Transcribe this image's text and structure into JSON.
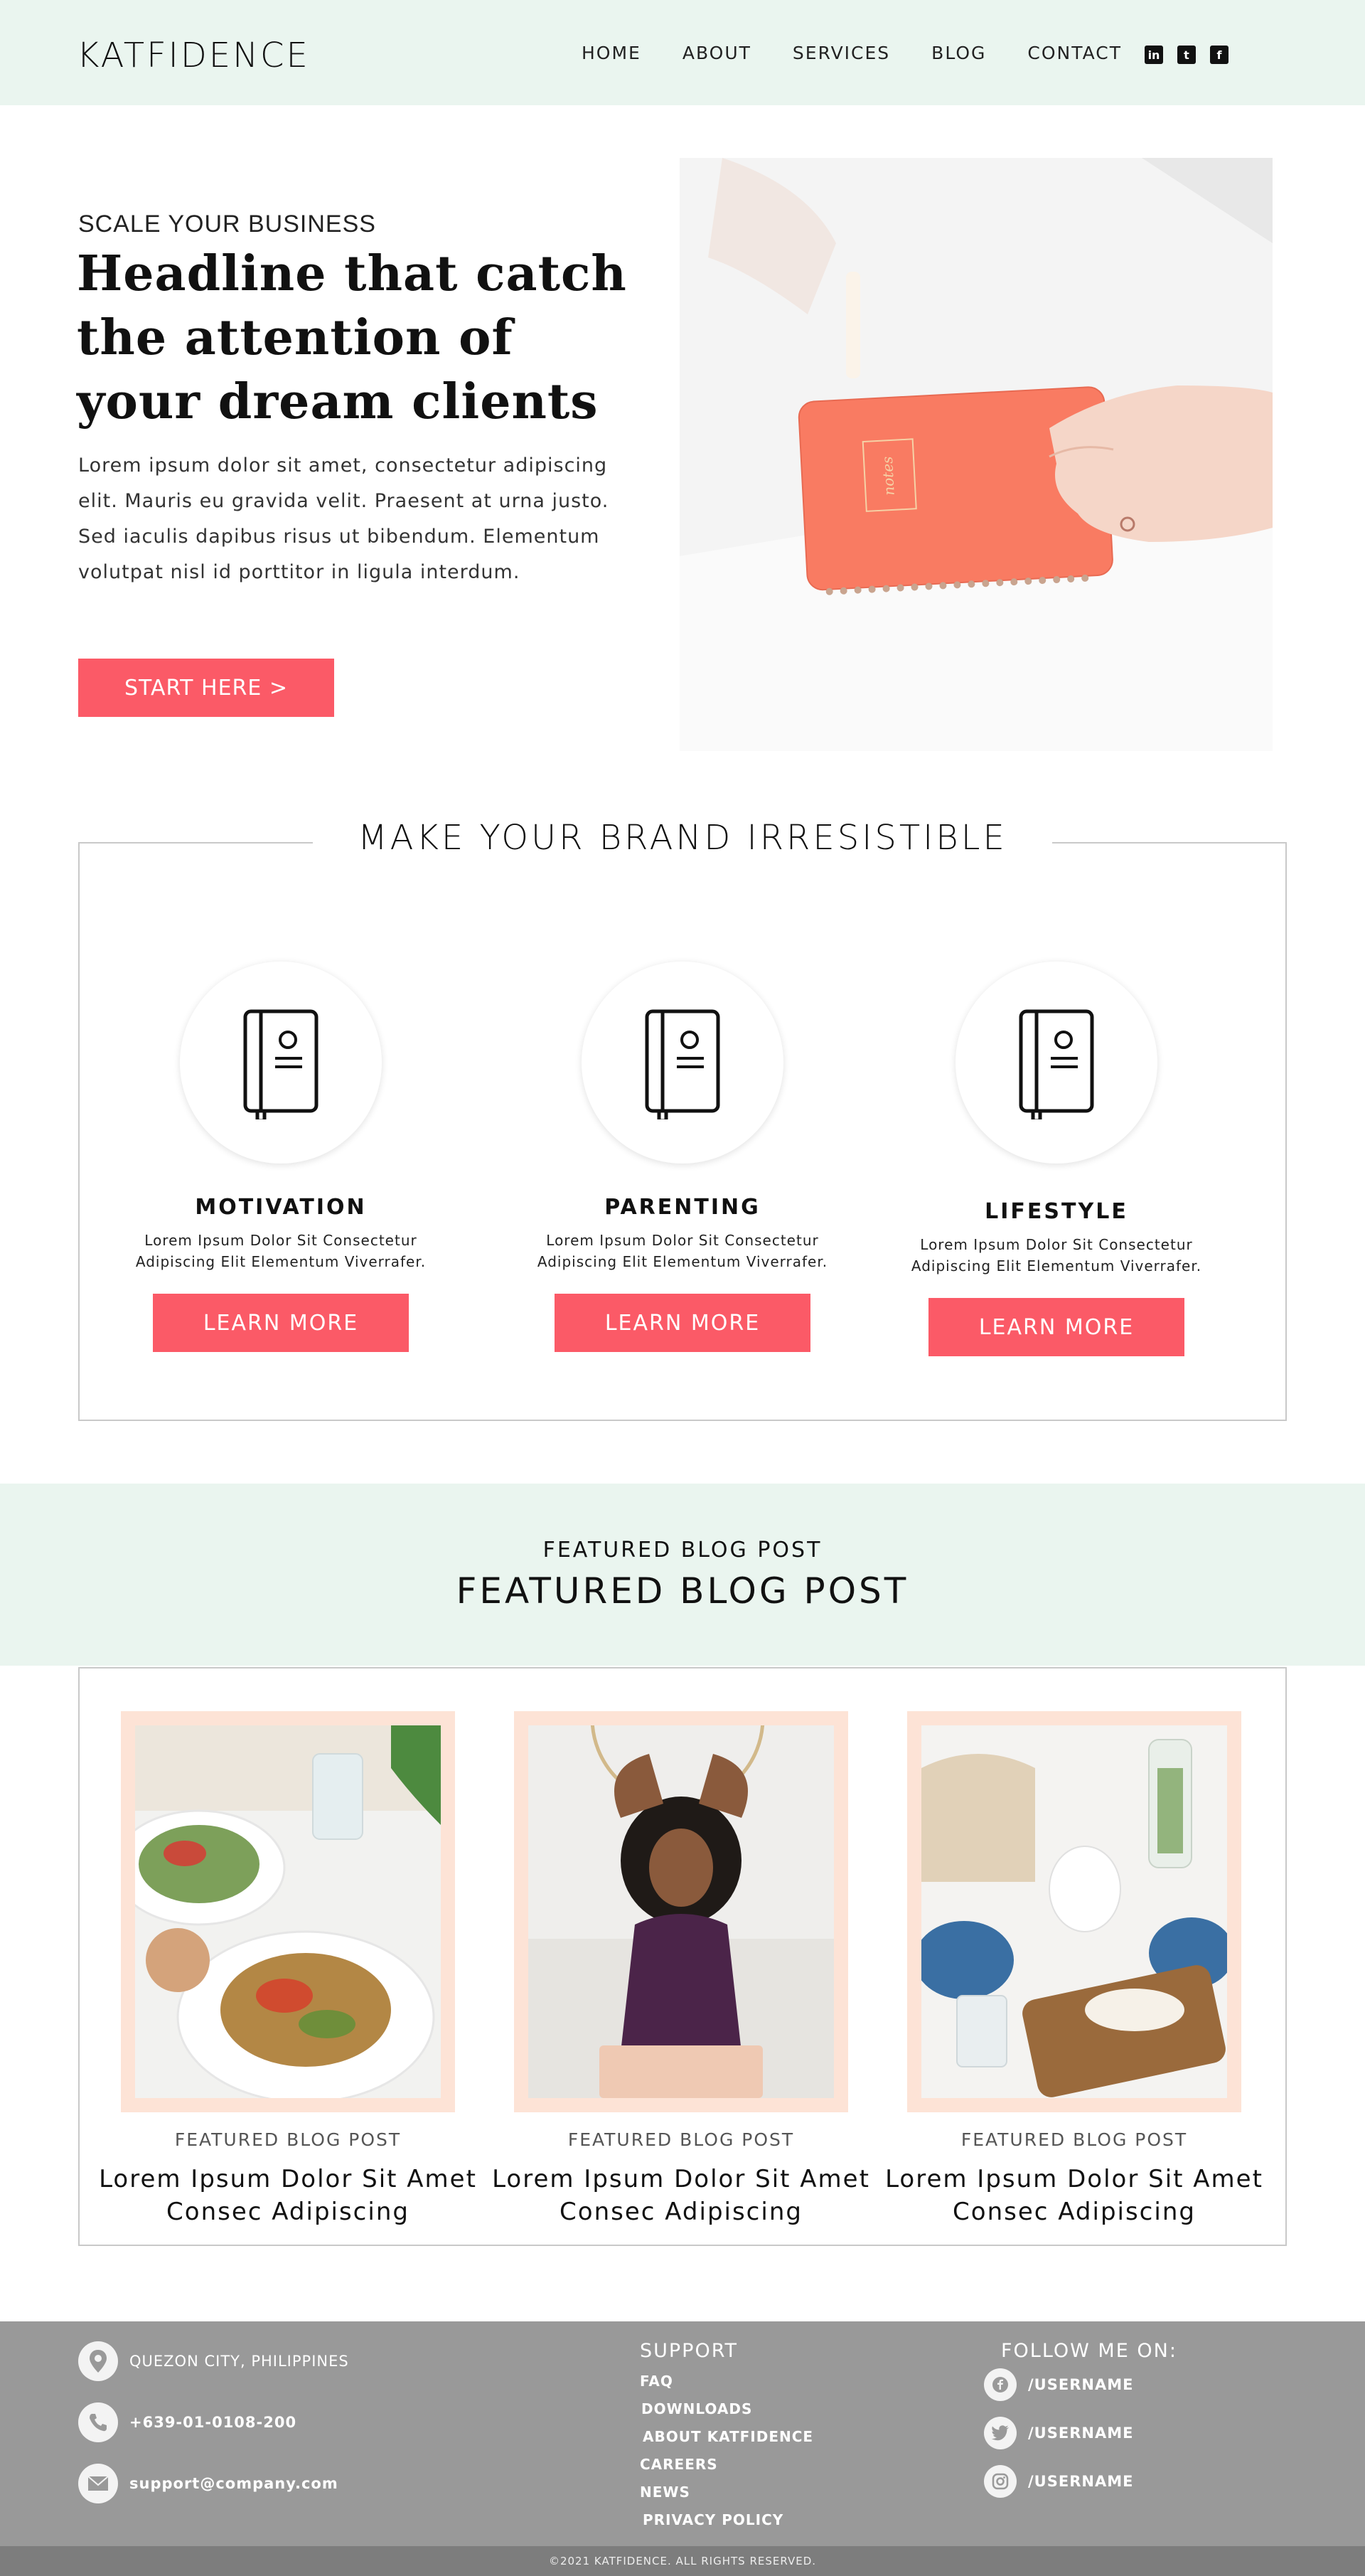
{
  "header": {
    "logo": "KATFIDENCE",
    "nav": [
      "HOME",
      "ABOUT",
      "SERVICES",
      "BLOG",
      "CONTACT"
    ],
    "social_icons": [
      "linkedin-icon",
      "tumblr-icon",
      "facebook-icon"
    ],
    "social_glyphs": [
      "in",
      "t",
      "f"
    ]
  },
  "hero": {
    "eyebrow": "SCALE YOUR BUSINESS",
    "title": "Headline that catch the attention of your dream clients",
    "body": "Lorem ipsum dolor sit amet, consectetur adipiscing elit. Mauris eu gravida velit. Praesent at urna justo. Sed iaculis dapibus risus ut bibendum. Elementum volutpat nisl id porttitor in ligula interdum.",
    "button": "START HERE >",
    "notebook_text": "notes"
  },
  "brand": {
    "title": "MAKE YOUR BRAND IRRESISTIBLE",
    "features": [
      {
        "title": "MOTIVATION",
        "desc": "Lorem Ipsum Dolor Sit Consectetur Adipiscing Elit Elementum Viverrafer.",
        "button": "LEARN MORE"
      },
      {
        "title": "PARENTING",
        "desc": "Lorem Ipsum Dolor Sit Consectetur Adipiscing Elit Elementum Viverrafer.",
        "button": "LEARN MORE"
      },
      {
        "title": "LIFESTYLE",
        "desc": "Lorem Ipsum Dolor Sit Consectetur Adipiscing Elit Elementum Viverrafer.",
        "button": "LEARN MORE"
      }
    ]
  },
  "featured": {
    "small": "FEATURED BLOG POST",
    "large": "FEATURED BLOG POST",
    "posts": [
      {
        "category": "FEATURED BLOG POST",
        "title": "Lorem Ipsum Dolor Sit Amet Consec Adipiscing"
      },
      {
        "category": "FEATURED BLOG POST",
        "title": "Lorem Ipsum Dolor Sit Amet Consec Adipiscing"
      },
      {
        "category": "FEATURED BLOG POST",
        "title": "Lorem Ipsum Dolor Sit Amet Consec Adipiscing"
      }
    ]
  },
  "footer": {
    "contact": [
      {
        "icon": "location-pin-icon",
        "text": "QUEZON CITY, PHILIPPINES"
      },
      {
        "icon": "phone-icon",
        "text": "+639-01-0108-200"
      },
      {
        "icon": "email-icon",
        "text": "support@company.com"
      }
    ],
    "support_heading": "SUPPORT",
    "support_links": [
      "FAQ",
      "DOWNLOADS",
      "ABOUT KATFIDENCE",
      "CAREERS",
      "NEWS",
      "PRIVACY POLICY"
    ],
    "follow_heading": "FOLLOW ME ON:",
    "follow": [
      {
        "icon": "facebook-icon",
        "text": "/USERNAME"
      },
      {
        "icon": "twitter-icon",
        "text": "/USERNAME"
      },
      {
        "icon": "instagram-icon",
        "text": "/USERNAME"
      }
    ],
    "copyright": "©2021 KATFIDENCE. ALL RIGHTS RESERVED."
  },
  "colors": {
    "accent": "#fb5a67",
    "mint": "#eaf5ef",
    "peach_frame": "#fde3d6",
    "footer_bg": "#999999",
    "copyright_bg": "#7d7d7d"
  }
}
